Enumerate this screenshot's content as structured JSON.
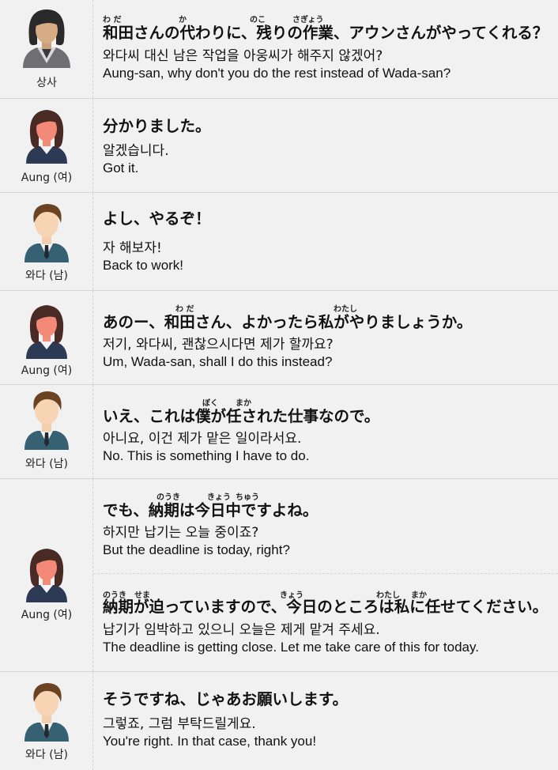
{
  "rows": [
    {
      "speaker": "상사",
      "lines": [
        {
          "ruby": [
            "わ だ",
            "か",
            "のこ",
            "さぎょう"
          ],
          "jp": "和田さんの代わりに、残りの作業、アウンさんがやってくれる？",
          "ko": "와다씨 대신 남은 작업을 아웅씨가 해주지 않겠어?",
          "en": "Aung-san, why don't you do the rest instead of Wada-san?"
        }
      ]
    },
    {
      "speaker": "Aung (여)",
      "lines": [
        {
          "ruby": [],
          "jp": "分かりました。",
          "ko": "알겠습니다.",
          "en": "Got it."
        }
      ]
    },
    {
      "speaker": "와다 (남)",
      "lines": [
        {
          "ruby": [],
          "jp": "よし、やるぞ！",
          "ko": "자 해보자!",
          "en": "Back to work!"
        }
      ]
    },
    {
      "speaker": "Aung (여)",
      "lines": [
        {
          "ruby": [
            "わ だ",
            "わたし"
          ],
          "jp": "あのー、和田さん、よかったら私がやりましょうか。",
          "ko": "저기, 와다씨, 괜찮으시다면 제가 할까요?",
          "en": "Um, Wada-san, shall I do this instead?"
        }
      ]
    },
    {
      "speaker": "와다 (남)",
      "lines": [
        {
          "ruby": [
            "ぼく",
            "まか"
          ],
          "jp": "いえ、これは僕が任された仕事なので。",
          "ko": "아니요, 이건 제가 맡은 일이라서요.",
          "en": "No. This is something I have to do."
        }
      ]
    },
    {
      "speaker": "Aung (여)",
      "lines": [
        {
          "ruby": [
            "のうき",
            "きょう",
            "ちゅう"
          ],
          "jp": "でも、納期は今日中ですよね。",
          "ko": "하지만 납기는 오늘 중이죠?",
          "en": "But the deadline is today, right?"
        },
        {
          "ruby": [
            "のうき",
            "せま",
            "きょう",
            "わたし",
            "まか"
          ],
          "jp": "納期が迫っていますので、今日のところは私に任せてください。",
          "ko": "납기가 임박하고 있으니 오늘은 제게 맡겨 주세요.",
          "en": "The deadline is getting close. Let me take care of this for today."
        }
      ]
    },
    {
      "speaker": "와다 (남)",
      "lines": [
        {
          "ruby": [],
          "jp": "そうですね、じゃあお願いします。",
          "ko": "그렇죠, 그럼 부탁드릴게요.",
          "en": "You're right. In that case, thank you!"
        }
      ]
    }
  ]
}
